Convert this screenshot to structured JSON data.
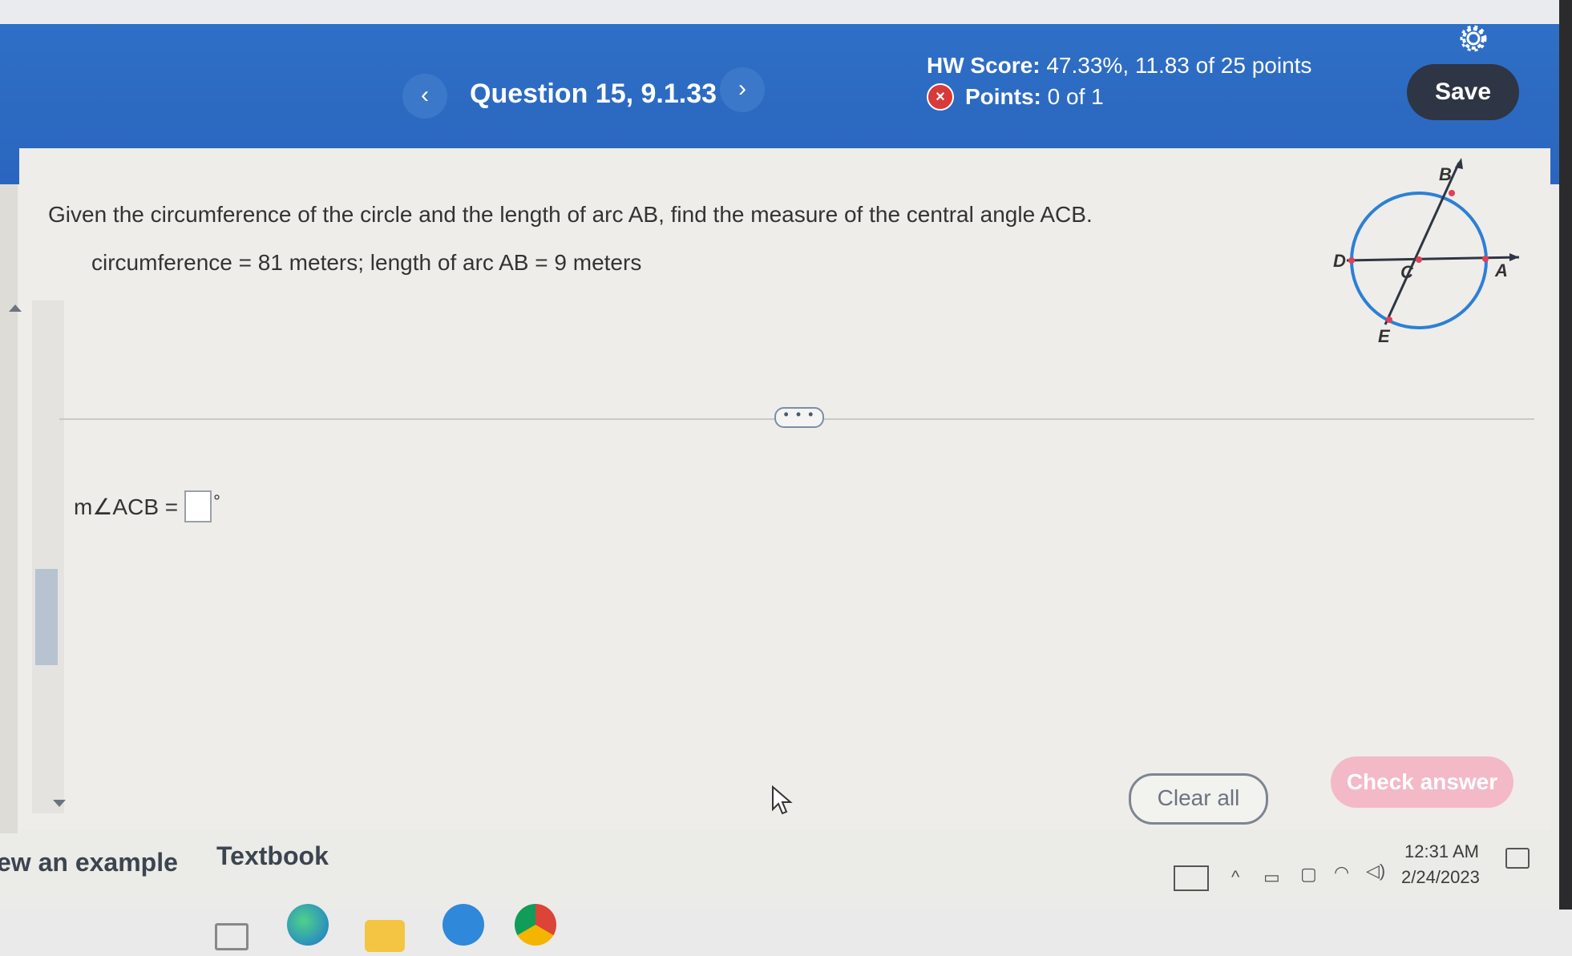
{
  "header": {
    "prev_label": "‹",
    "next_label": "›",
    "question_title": "Question 15, 9.1.33",
    "hw_score_label": "HW Score:",
    "hw_score_value": "47.33%, 11.83 of 25 points",
    "points_label": "Points:",
    "points_value": "0 of 1",
    "save_label": "Save"
  },
  "question": {
    "prompt": "Given the circumference of the circle and the length of arc AB, find the measure of the central angle ACB.",
    "given": "circumference = 81 meters; length of arc AB = 9 meters",
    "answer_label": "m∠ACB =",
    "answer_value": "",
    "degree_symbol": "°"
  },
  "diagram": {
    "points": [
      "B",
      "A",
      "D",
      "C",
      "E"
    ],
    "circle_color": "#2d7fd6"
  },
  "actions": {
    "more_label": "• • •",
    "clear_label": "Clear all",
    "check_label": "Check answer"
  },
  "bottom_links": {
    "example_label": "ew an example",
    "textbook_label": "Textbook"
  },
  "taskbar": {
    "time": "12:31 AM",
    "date": "2/24/2023"
  },
  "colors": {
    "header_blue": "#2f6fc6",
    "save_button": "#2e3544",
    "check_button": "#f3b9c7",
    "error_red": "#d83a3a"
  }
}
